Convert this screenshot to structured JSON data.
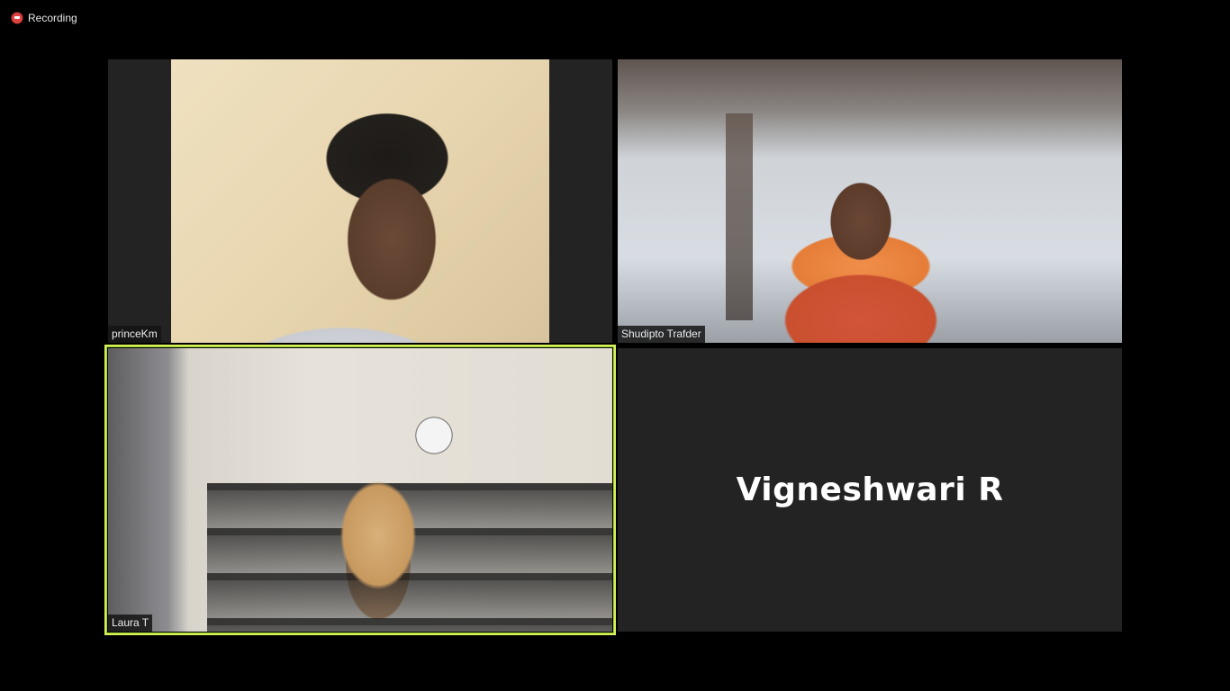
{
  "recording": {
    "label": "Recording",
    "icon": "record-icon",
    "color": "#e04242"
  },
  "participants": [
    {
      "name": "princeKm",
      "has_video": true
    },
    {
      "name": "Shudipto Trafder",
      "has_video": true
    },
    {
      "name": "Laura T",
      "has_video": true,
      "active_speaker": true
    },
    {
      "name": "Vigneshwari R",
      "has_video": false
    }
  ],
  "colors": {
    "background": "#000000",
    "tile_background": "#232323",
    "active_speaker_border": "#d6f05b"
  }
}
